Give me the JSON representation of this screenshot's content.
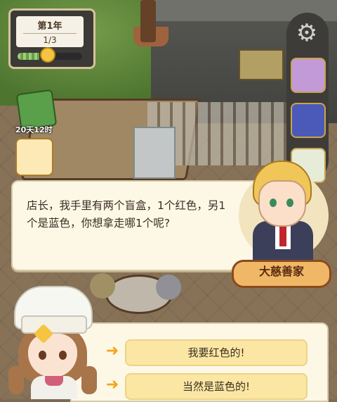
{
  "hud": {
    "year_label": "第1年",
    "season_progress": "1/3",
    "season_progress_fraction": 0.333,
    "days_remaining": "20天12时"
  },
  "icons": {
    "settings": "gear-icon",
    "bill": "bill-icon",
    "task": "task-icon",
    "side_1": "pig-character-icon",
    "side_2": "book-icon",
    "side_3": "gift-icon",
    "arrow": "arrow-right-icon"
  },
  "dialog": {
    "text": "店长，我手里有两个盲盒，1个红色，另1个是蓝色，你想拿走哪1个呢?",
    "speaker_name": "大慈善家"
  },
  "choices": [
    {
      "label": "我要红色的!"
    },
    {
      "label": "当然是蓝色的!"
    }
  ],
  "colors": {
    "dialog_bg": "#fdf7e6",
    "choice_bg": "#fbe7a3",
    "name_tag": "#f0b866",
    "arrow": "#f3a51c"
  }
}
